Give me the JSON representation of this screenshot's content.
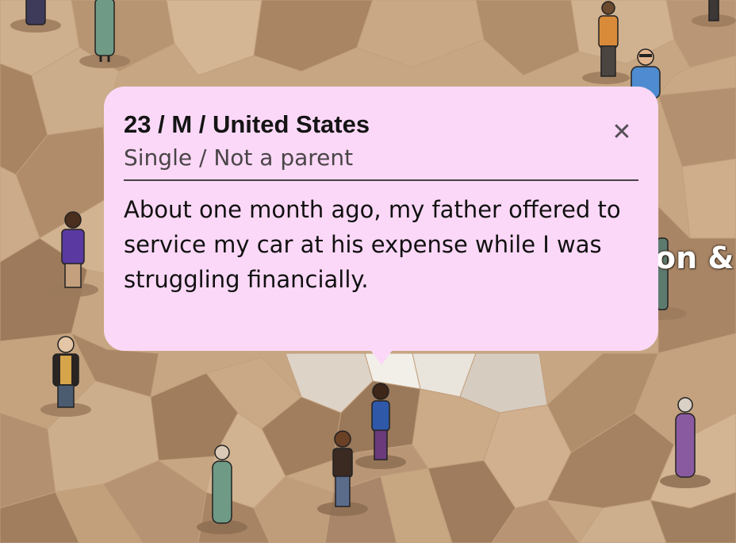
{
  "map": {
    "label": "on & s"
  },
  "popup": {
    "title": "23 / M / United States",
    "subtitle": "Single / Not a parent",
    "story": "About one month ago, my father offered to service my car at his expense while I was struggling financially.",
    "close_icon": "close-icon"
  }
}
